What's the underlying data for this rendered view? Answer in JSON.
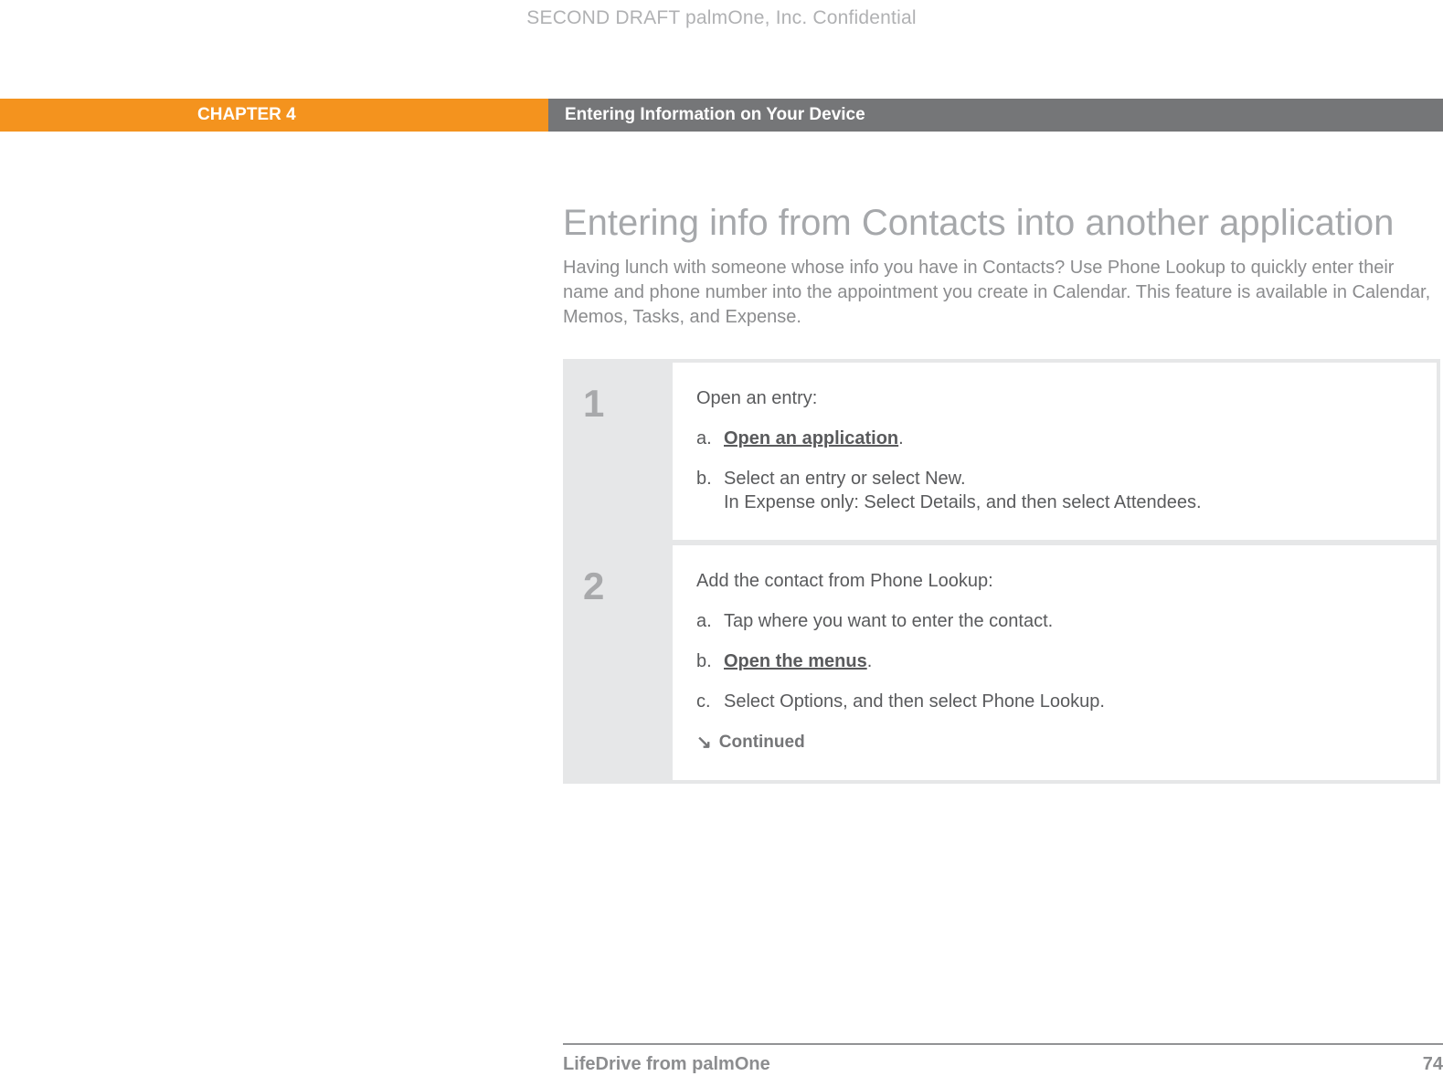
{
  "watermark": "SECOND DRAFT palmOne, Inc.  Confidential",
  "header": {
    "chapter": "CHAPTER 4",
    "title": "Entering Information on Your Device"
  },
  "section": {
    "title": "Entering info from Contacts into another application",
    "intro": "Having lunch with someone whose info you have in Contacts? Use Phone Lookup to quickly enter their name and phone number into the appointment you create in Calendar. This feature is available in Calendar, Memos, Tasks, and Expense."
  },
  "steps": [
    {
      "num": "1",
      "lead": "Open an entry:",
      "subs": [
        {
          "marker": "a.",
          "pre": "",
          "link": "Open an application",
          "post": "."
        },
        {
          "marker": "b.",
          "text": "Select an entry or select New.",
          "text2": "In Expense only: Select Details, and then select Attendees."
        }
      ]
    },
    {
      "num": "2",
      "lead": "Add the contact from Phone Lookup:",
      "subs": [
        {
          "marker": "a.",
          "text": "Tap where you want to enter the contact."
        },
        {
          "marker": "b.",
          "pre": "",
          "link": "Open the menus",
          "post": "."
        },
        {
          "marker": "c.",
          "text": "Select Options, and then select Phone Lookup."
        }
      ],
      "continued": "Continued"
    }
  ],
  "footer": {
    "product": "LifeDrive from palmOne",
    "page": "74"
  }
}
